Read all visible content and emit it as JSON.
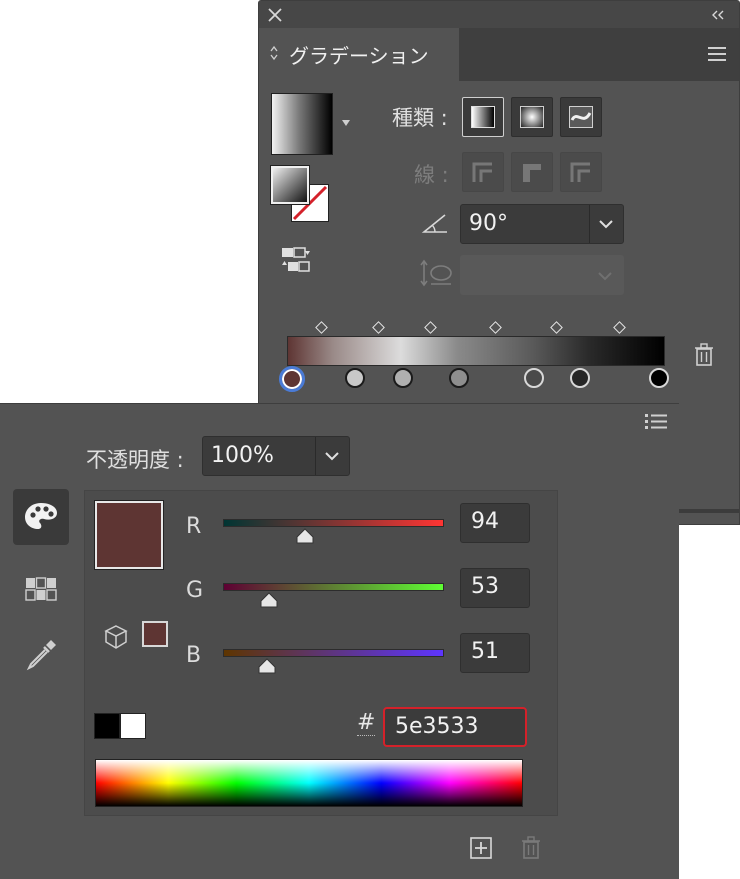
{
  "gradient_panel": {
    "title": "グラデーション",
    "type_label": "種類 :",
    "stroke_label": "線 :",
    "angle_value": "90°",
    "stops_count": 7
  },
  "color_panel": {
    "opacity_label": "不透明度 :",
    "opacity_value": "100%",
    "swatch_color": "#5e3533",
    "channels": [
      {
        "label": "R",
        "value": "94",
        "level": 0.369
      },
      {
        "label": "G",
        "value": "53",
        "level": 0.208
      },
      {
        "label": "B",
        "value": "51",
        "level": 0.2
      }
    ],
    "hash_label": "#",
    "hex_value": "5e3533"
  },
  "icons": {
    "close": "close-icon",
    "collapse": "double-chevron-left-icon",
    "menu": "hamburger-menu-icon",
    "trash": "trash-icon",
    "palette": "palette-icon",
    "grid": "swatch-grid-icon",
    "eyedropper": "eyedropper-icon",
    "cube": "cube-icon",
    "add": "add-square-icon"
  },
  "colors": {
    "panel_bg": "#535353",
    "accent_red": "#d4212a",
    "selected_stop_ring": "#4a7bd6"
  }
}
